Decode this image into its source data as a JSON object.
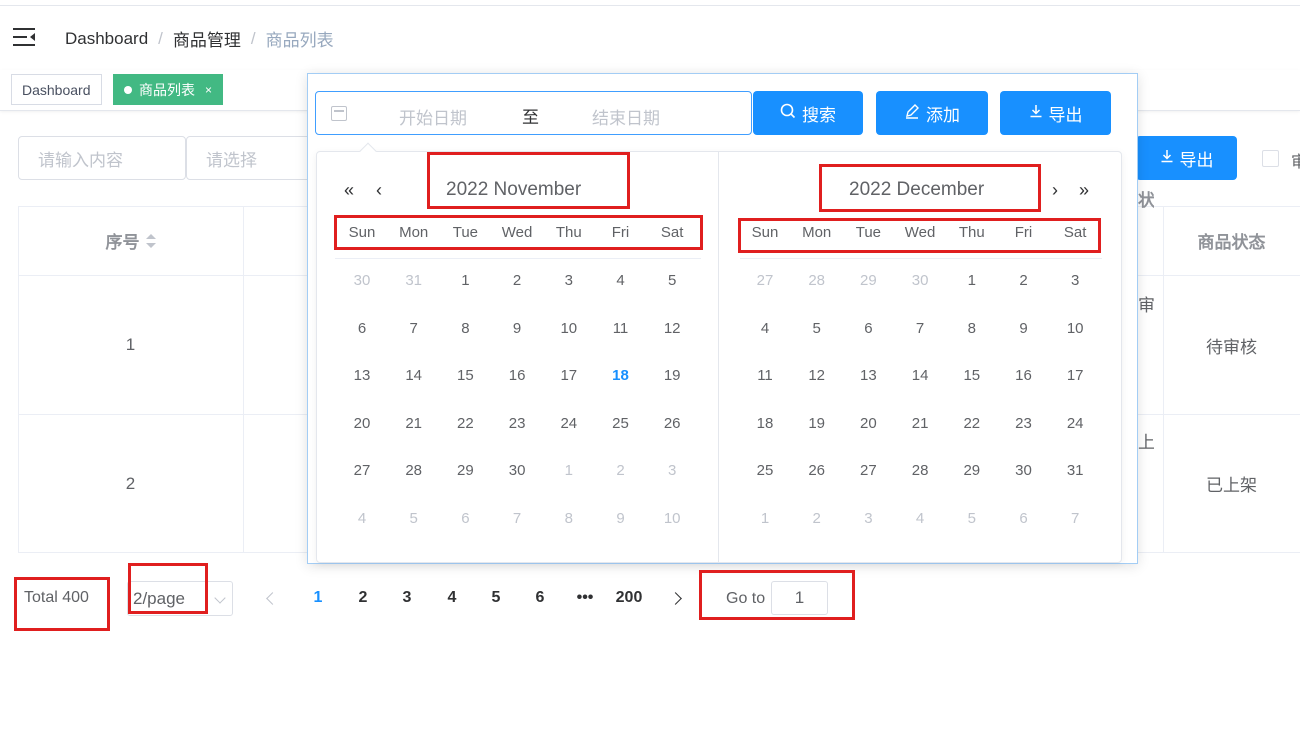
{
  "breadcrumb": {
    "home": "Dashboard",
    "parent": "商品管理",
    "current": "商品列表",
    "separator": "/"
  },
  "tags": {
    "dashboard": "Dashboard",
    "active": "商品列表",
    "close": "×"
  },
  "filters": {
    "keyword_placeholder": "请输入内容",
    "select_placeholder": "请选择",
    "export_label": "导出",
    "checkbox_label": "审"
  },
  "table": {
    "headers": {
      "index": "序号",
      "status": "商品状态",
      "col3_partial": "状"
    },
    "rows": [
      {
        "index": "1",
        "status": "待审核",
        "partial": "审核"
      },
      {
        "index": "2",
        "status": "已上架",
        "partial": "上架"
      }
    ]
  },
  "pagination": {
    "total": "Total 400",
    "page_size": "2/page",
    "pages": [
      "1",
      "2",
      "3",
      "4",
      "5",
      "6",
      "•••",
      "200"
    ],
    "current_page": "1",
    "goto_label": "Go to",
    "goto_value": "1"
  },
  "date_range": {
    "start_placeholder": "开始日期",
    "separator": "至",
    "end_placeholder": "结束日期"
  },
  "popup_buttons": {
    "search": "搜索",
    "add": "添加",
    "export": "导出"
  },
  "calendar": {
    "left_title": "2022 November",
    "right_title": "2022 December",
    "nav": {
      "prev_year": "«",
      "prev_month": "‹",
      "next_month": "›",
      "next_year": "»"
    },
    "weekdays": [
      "Sun",
      "Mon",
      "Tue",
      "Wed",
      "Thu",
      "Fri",
      "Sat"
    ],
    "today": "18",
    "left_days": [
      [
        "30",
        "31",
        "1",
        "2",
        "3",
        "4",
        "5"
      ],
      [
        "6",
        "7",
        "8",
        "9",
        "10",
        "11",
        "12"
      ],
      [
        "13",
        "14",
        "15",
        "16",
        "17",
        "18",
        "19"
      ],
      [
        "20",
        "21",
        "22",
        "23",
        "24",
        "25",
        "26"
      ],
      [
        "27",
        "28",
        "29",
        "30",
        "1",
        "2",
        "3"
      ],
      [
        "4",
        "5",
        "6",
        "7",
        "8",
        "9",
        "10"
      ]
    ],
    "right_days": [
      [
        "27",
        "28",
        "29",
        "30",
        "1",
        "2",
        "3"
      ],
      [
        "4",
        "5",
        "6",
        "7",
        "8",
        "9",
        "10"
      ],
      [
        "11",
        "12",
        "13",
        "14",
        "15",
        "16",
        "17"
      ],
      [
        "18",
        "19",
        "20",
        "21",
        "22",
        "23",
        "24"
      ],
      [
        "25",
        "26",
        "27",
        "28",
        "29",
        "30",
        "31"
      ],
      [
        "1",
        "2",
        "3",
        "4",
        "5",
        "6",
        "7"
      ]
    ]
  },
  "colors": {
    "primary": "#1890ff",
    "tag_active": "#42b983",
    "annotation": "#e01f1f"
  },
  "icons": [
    "hamburger-icon",
    "sort-icon",
    "calendar-icon",
    "search-icon",
    "edit-icon",
    "download-icon",
    "chevron-down-icon"
  ]
}
